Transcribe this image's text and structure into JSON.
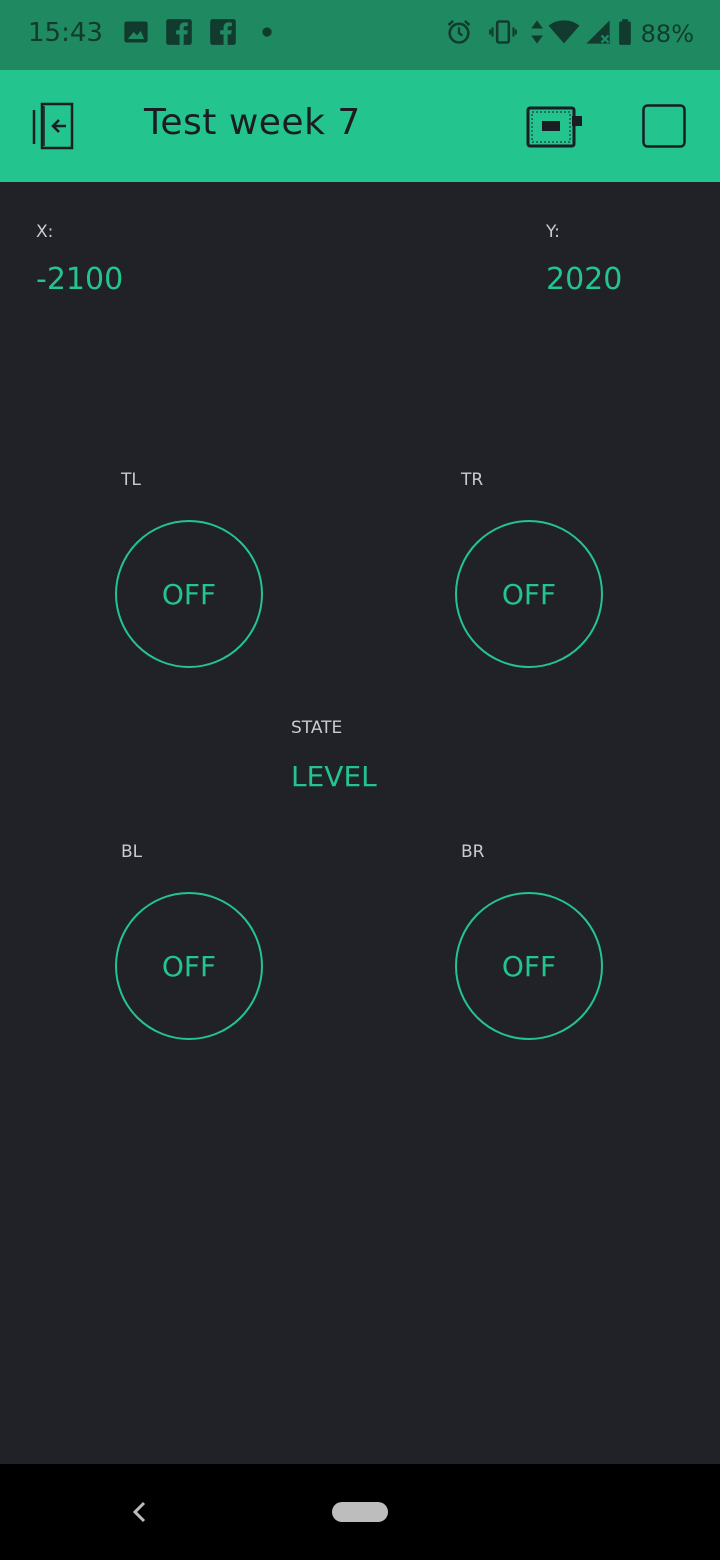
{
  "status_bar": {
    "time": "15:43",
    "battery_percent": "88%",
    "icons": [
      "image-icon",
      "facebook-icon",
      "facebook-icon",
      "dot-icon",
      "alarm-icon",
      "vibrate-icon",
      "data-arrows-icon",
      "wifi-icon",
      "signal-icon",
      "battery-icon"
    ]
  },
  "app_bar": {
    "title": "Test week 7",
    "icons": [
      "exit-icon",
      "device-board-icon",
      "stop-square-icon"
    ]
  },
  "display": {
    "x": {
      "label": "X:",
      "value": "-2100"
    },
    "y": {
      "label": "Y:",
      "value": "2020"
    },
    "state": {
      "label": "STATE",
      "value": "LEVEL"
    }
  },
  "buttons": {
    "tl": {
      "label": "TL",
      "state": "OFF"
    },
    "tr": {
      "label": "TR",
      "state": "OFF"
    },
    "bl": {
      "label": "BL",
      "state": "OFF"
    },
    "br": {
      "label": "BR",
      "state": "OFF"
    }
  },
  "colors": {
    "accent": "#23c48e",
    "status_bar": "#1f8a61",
    "background": "#212227",
    "nav_bar": "#000000"
  }
}
